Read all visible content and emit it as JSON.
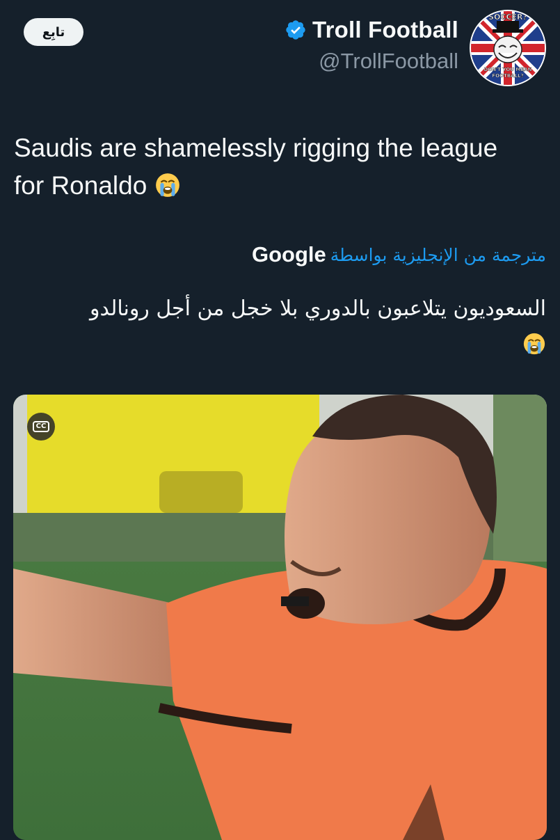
{
  "follow_button": {
    "label": "تابِع"
  },
  "author": {
    "display_name": "Troll Football",
    "handle": "@TrollFootball",
    "verified_icon": "verified-badge-icon",
    "verified_color": "#1d9bf0"
  },
  "avatar": {
    "top_text": "SOCCER?",
    "bottom_text_1": "DON'T YOU MEAN",
    "bottom_text_2": "FOOTBALL?"
  },
  "tweet": {
    "text": "Saudis are shamelessly rigging the league for Ronaldo",
    "emoji": "loudly-crying-face-emoji"
  },
  "translation": {
    "label": "مترجمة من الإنجليزية بواسطة",
    "provider": "Google",
    "text": "السعوديون يتلاعبون بالدوري بلا خجل من أجل رونالدو",
    "link_color": "#1d9bf0"
  },
  "media": {
    "cc_label": "CC",
    "cc_icon": "closed-captions-icon"
  },
  "colors": {
    "background": "#15202b",
    "text_primary": "#f7f9f9",
    "text_secondary": "#8b98a5",
    "referee_shirt": "#f07a4a"
  }
}
